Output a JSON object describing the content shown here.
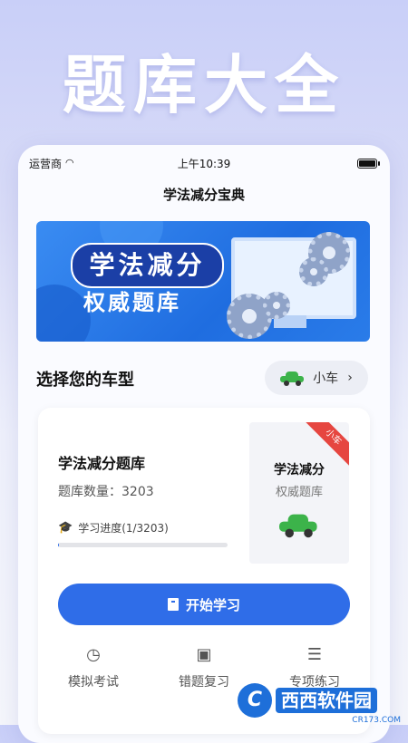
{
  "hero": {
    "title": "题库大全"
  },
  "status_bar": {
    "carrier": "运营商",
    "time": "上午10:39"
  },
  "app": {
    "title": "学法减分宝典"
  },
  "banner": {
    "line1": "学法减分",
    "line2": "权威题库"
  },
  "car_section": {
    "label": "选择您的车型",
    "selected_car": "小车",
    "chevron": "›"
  },
  "question_bank": {
    "title": "学法减分题库",
    "count_text": "题库数量：3203",
    "progress_text": "学习进度(1/3203)",
    "progress_fraction": 0.0003,
    "cover_title": "学法减分",
    "cover_subtitle": "权威题库",
    "ribbon": "小车"
  },
  "start_button": {
    "label": "开始学习"
  },
  "tabs": [
    {
      "label": "模拟考试",
      "icon": "clock-icon"
    },
    {
      "label": "错题复习",
      "icon": "calendar-x-icon"
    },
    {
      "label": "专项练习",
      "icon": "list-icon"
    }
  ],
  "watermark": {
    "brand": "西西软件园",
    "url": "CR173.COM"
  },
  "colors": {
    "accent": "#2f6de8",
    "car_green": "#3cb34a",
    "ribbon_red": "#e64640"
  }
}
